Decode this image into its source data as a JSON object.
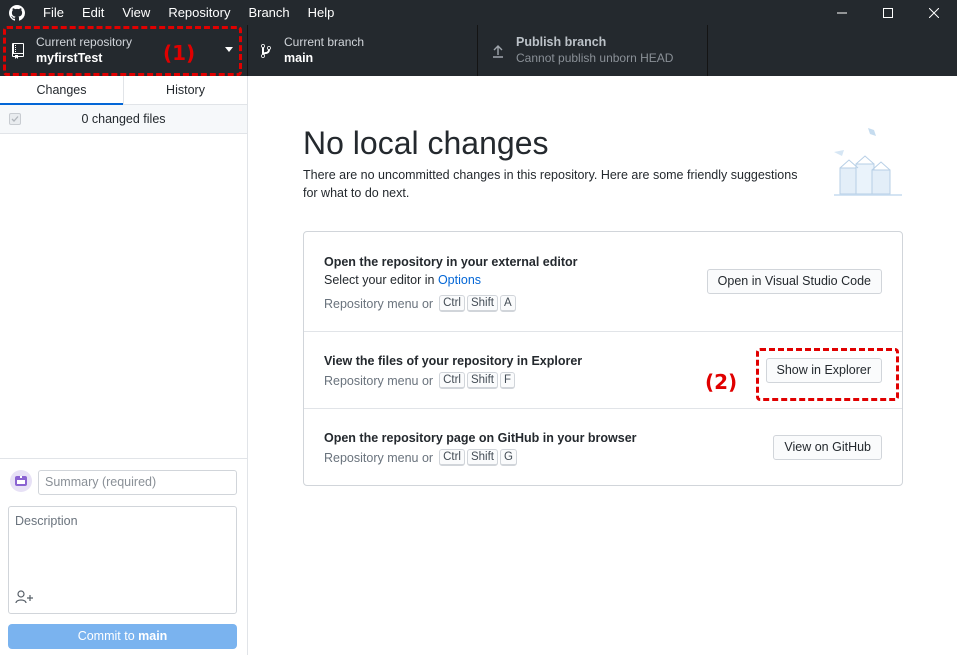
{
  "menu": [
    "File",
    "Edit",
    "View",
    "Repository",
    "Branch",
    "Help"
  ],
  "toolbar": {
    "repo_label": "Current repository",
    "repo_value": "myfirstTest",
    "branch_label": "Current branch",
    "branch_value": "main",
    "publish_label": "Publish branch",
    "publish_value": "Cannot publish unborn HEAD"
  },
  "annotations": {
    "first": "(1)",
    "second": "(2)",
    "color": "#e00000"
  },
  "sidebar": {
    "tabs": [
      "Changes",
      "History"
    ],
    "changed_files": "0 changed files",
    "summary_placeholder": "Summary (required)",
    "description_placeholder": "Description",
    "commit_prefix": "Commit to ",
    "commit_branch": "main"
  },
  "main": {
    "title": "No local changes",
    "subtitle": "There are no uncommitted changes in this repository. Here are some friendly suggestions for what to do next.",
    "cards": [
      {
        "title": "Open the repository in your external editor",
        "line_prefix": "Select your editor in ",
        "line_link": "Options",
        "shortcut_lead": "Repository menu or",
        "keys": [
          "Ctrl",
          "Shift",
          "A"
        ],
        "button": "Open in Visual Studio Code"
      },
      {
        "title": "View the files of your repository in Explorer",
        "shortcut_lead": "Repository menu or",
        "keys": [
          "Ctrl",
          "Shift",
          "F"
        ],
        "button": "Show in Explorer"
      },
      {
        "title": "Open the repository page on GitHub in your browser",
        "shortcut_lead": "Repository menu or",
        "keys": [
          "Ctrl",
          "Shift",
          "G"
        ],
        "button": "View on GitHub"
      }
    ]
  },
  "colors": {
    "titlebar": "#24292e",
    "accent": "#0366d6",
    "commit_button": "#7ab3ef"
  }
}
